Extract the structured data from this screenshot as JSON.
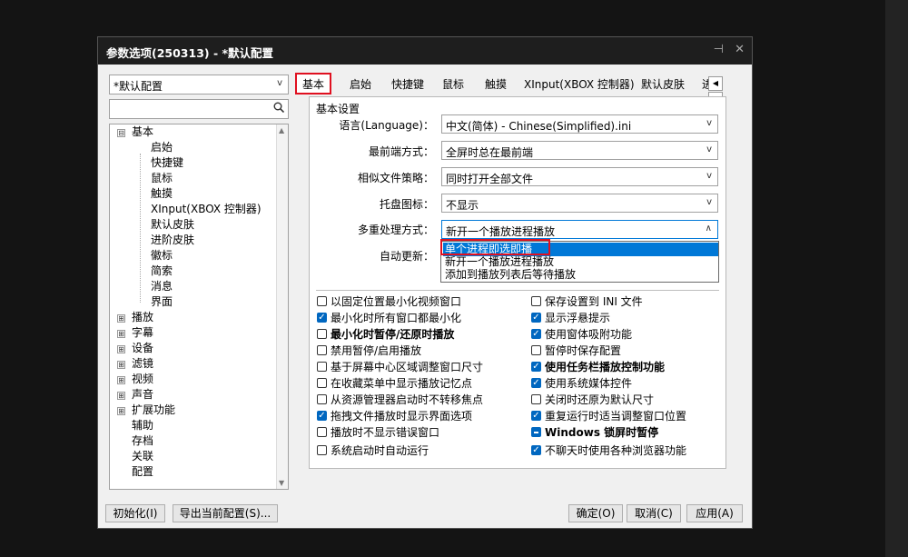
{
  "dialog": {
    "title": "参数选项(250313) - *默认配置",
    "pin_icon": "pin-icon",
    "close_icon": "close-icon"
  },
  "profile_select": {
    "value": "*默认配置"
  },
  "search": {
    "placeholder": "",
    "value": ""
  },
  "tree": {
    "items": [
      {
        "label": "基本",
        "expander": "⊟",
        "level": 0
      },
      {
        "label": "启始",
        "level": 1
      },
      {
        "label": "快捷键",
        "level": 1
      },
      {
        "label": "鼠标",
        "level": 1
      },
      {
        "label": "触摸",
        "level": 1
      },
      {
        "label": "XInput(XBOX 控制器)",
        "level": 1
      },
      {
        "label": "默认皮肤",
        "level": 1
      },
      {
        "label": "进阶皮肤",
        "level": 1
      },
      {
        "label": "徽标",
        "level": 1
      },
      {
        "label": "简索",
        "level": 1
      },
      {
        "label": "消息",
        "level": 1
      },
      {
        "label": "界面",
        "level": 1
      },
      {
        "label": "播放",
        "expander": "⊞",
        "level": 0
      },
      {
        "label": "字幕",
        "expander": "⊞",
        "level": 0
      },
      {
        "label": "设备",
        "expander": "⊞",
        "level": 0
      },
      {
        "label": "滤镜",
        "expander": "⊞",
        "level": 0
      },
      {
        "label": "视频",
        "expander": "⊞",
        "level": 0
      },
      {
        "label": "声音",
        "expander": "⊞",
        "level": 0
      },
      {
        "label": "扩展功能",
        "expander": "⊞",
        "level": 0
      },
      {
        "label": "辅助",
        "level": 0
      },
      {
        "label": "存档",
        "level": 0
      },
      {
        "label": "关联",
        "level": 0
      },
      {
        "label": "配置",
        "level": 0
      }
    ]
  },
  "tabs": [
    {
      "label": "基本",
      "active": true
    },
    {
      "label": "启始"
    },
    {
      "label": "快捷键"
    },
    {
      "label": "鼠标"
    },
    {
      "label": "触摸"
    },
    {
      "label": "XInput(XBOX 控制器)"
    },
    {
      "label": "默认皮肤"
    },
    {
      "label": "进"
    }
  ],
  "group": {
    "title": "基本设置",
    "language_label": "语言(Language)：",
    "language_value": "中文(简体) - Chinese(Simplified).ini",
    "topmost_label": "最前端方式：",
    "topmost_value": "全屏时总在最前端",
    "similar_label": "相似文件策略：",
    "similar_value": "同时打开全部文件",
    "tray_label": "托盘图标：",
    "tray_value": "不显示",
    "multi_label": "多重处理方式：",
    "multi_value": "新开一个播放进程播放",
    "update_label": "自动更新："
  },
  "dropdown": {
    "options": [
      "单个进程即选即播",
      "新开一个播放进程播放",
      "添加到播放列表后等待播放"
    ],
    "selected": "单个进程即选即播"
  },
  "checkboxes_left": [
    {
      "label": "以固定位置最小化视频窗口",
      "state": "off"
    },
    {
      "label": "最小化时所有窗口都最小化",
      "state": "on"
    },
    {
      "label": "最小化时暂停/还原时播放",
      "state": "off",
      "bold": true
    },
    {
      "label": "禁用暂停/启用播放",
      "state": "off"
    },
    {
      "label": "基于屏幕中心区域调整窗口尺寸",
      "state": "off"
    },
    {
      "label": "在收藏菜单中显示播放记忆点",
      "state": "off"
    },
    {
      "label": "从资源管理器启动时不转移焦点",
      "state": "off"
    },
    {
      "label": "拖拽文件播放时显示界面选项",
      "state": "on"
    },
    {
      "label": "播放时不显示错误窗口",
      "state": "off"
    },
    {
      "label": "系统启动时自动运行",
      "state": "off"
    }
  ],
  "checkboxes_right": [
    {
      "label": "保存设置到 INI 文件",
      "state": "off"
    },
    {
      "label": "显示浮悬提示",
      "state": "on"
    },
    {
      "label": "使用窗体吸附功能",
      "state": "on"
    },
    {
      "label": "暂停时保存配置",
      "state": "off"
    },
    {
      "label": "使用任务栏播放控制功能",
      "state": "on",
      "bold": true
    },
    {
      "label": "使用系统媒体控件",
      "state": "on"
    },
    {
      "label": "关闭时还原为默认尺寸",
      "state": "off"
    },
    {
      "label": "重复运行时适当调整窗口位置",
      "state": "on"
    },
    {
      "label": "Windows 锁屏时暂停",
      "state": "partial",
      "bold": true
    },
    {
      "label": "不聊天时使用各种浏览器功能",
      "state": "on"
    }
  ],
  "footer": {
    "reset": "初始化(I)",
    "export": "导出当前配置(S)...",
    "ok": "确定(O)",
    "cancel": "取消(C)",
    "apply": "应用(A)"
  },
  "colors": {
    "accent": "#0078d7",
    "highlight_box": "#e01020",
    "titlebar": "#1e1e1e"
  }
}
